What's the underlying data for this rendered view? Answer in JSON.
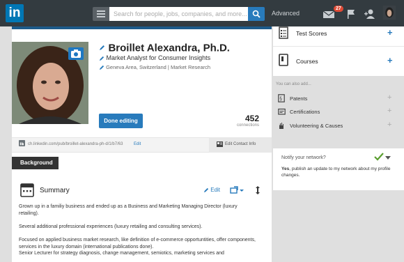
{
  "nav": {
    "logo": "in",
    "search_placeholder": "Search for people, jobs, companies, and more...",
    "advanced": "Advanced",
    "message_badge": "27"
  },
  "profile": {
    "name": "Broillet Alexandra, Ph.D.",
    "headline": "Market Analyst for Consumer Insights",
    "location": "Geneva Area, Switzerland",
    "industry": "Market Research",
    "location_separator": "|",
    "done_editing": "Done editing",
    "connections_count": "452",
    "connections_label": "connections",
    "public_url": "ch.linkedin.com/pub/broillet-alexandra-ph-d/1/b7/63",
    "url_edit": "Edit",
    "contact_info": "Edit Contact Info"
  },
  "background_tab": "Background",
  "summary": {
    "title": "Summary",
    "edit": "Edit",
    "paragraphs": [
      "Grown up in a familiy business and ended up as a Business and Marketing Managing Director (luxury retailing).",
      "Several additional professional experiences (luxury retailing and consulting services).",
      "Focused on applied business market research, like definition of e-commerce opportuntities, offer components, services in the luxury domain (international publications done).",
      "Senior Lecturer for strategy diagnosis, change management, semiotics, marketing services and"
    ]
  },
  "sidebar": {
    "sections": [
      {
        "label": "Test Scores",
        "plus": "+"
      },
      {
        "label": "Courses",
        "plus": "+"
      }
    ],
    "also_add_label": "You can also add...",
    "also_add": [
      {
        "label": "Patents",
        "plus": "+"
      },
      {
        "label": "Certifications",
        "plus": "+"
      },
      {
        "label": "Volunteering & Causes",
        "plus": "+"
      }
    ],
    "notify": {
      "title": "Notify your network?",
      "bold": "Yes",
      "text": ", publish an update to my network about my profile changes."
    }
  },
  "colors": {
    "brand": "#0077b5",
    "topbar": "#333b40",
    "accent_blue": "#287bbc",
    "check_green": "#5a9e2f",
    "badge_red": "#e04a35"
  }
}
